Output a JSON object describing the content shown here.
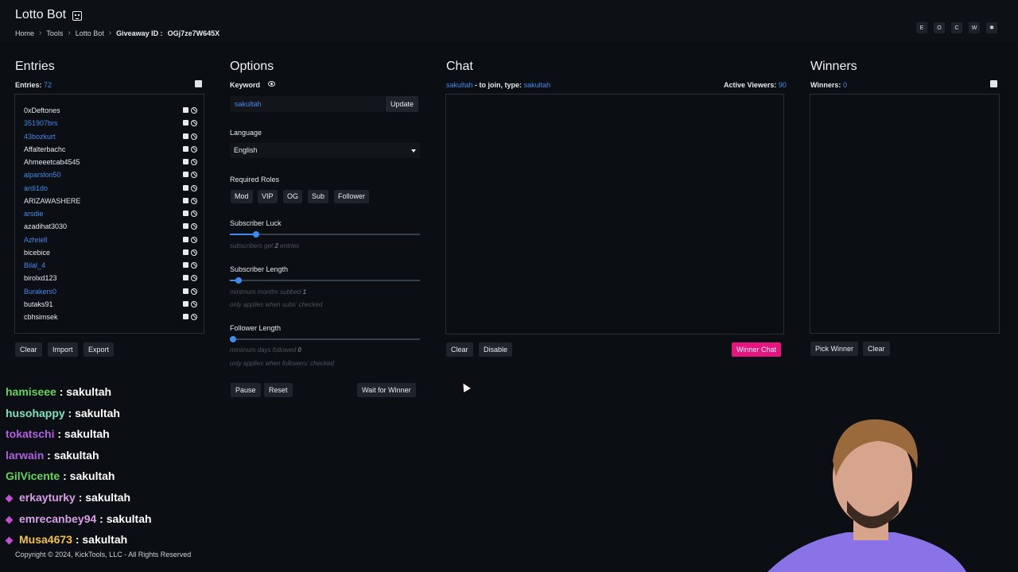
{
  "app": {
    "title": "Lotto Bot"
  },
  "breadcrumb": {
    "home": "Home",
    "tools": "Tools",
    "current": "Lotto Bot",
    "giveaway_label": "Giveaway ID :",
    "giveaway_id": "OGj7ze7W645X"
  },
  "top_buttons": [
    "E",
    "O",
    "C",
    "W",
    "✱"
  ],
  "entries": {
    "title": "Entries",
    "count_label": "Entries:",
    "count": "72",
    "items": [
      {
        "name": "0xDeftones",
        "sub": false
      },
      {
        "name": "351907brs",
        "sub": true
      },
      {
        "name": "43bozkurt",
        "sub": true
      },
      {
        "name": "Affalterbachc",
        "sub": false
      },
      {
        "name": "Ahmeeetcab4545",
        "sub": false
      },
      {
        "name": "alparslon50",
        "sub": true
      },
      {
        "name": "ardi1do",
        "sub": true
      },
      {
        "name": "ARIZAWASHERE",
        "sub": false
      },
      {
        "name": "arsdie",
        "sub": true
      },
      {
        "name": "azadihat3030",
        "sub": false
      },
      {
        "name": "Azhriell",
        "sub": true
      },
      {
        "name": "bicebice",
        "sub": false
      },
      {
        "name": "Bilal_4",
        "sub": true
      },
      {
        "name": "birolxd123",
        "sub": false
      },
      {
        "name": "Burakers0",
        "sub": true
      },
      {
        "name": "butaks91",
        "sub": false
      },
      {
        "name": "cbhsimsek",
        "sub": false
      }
    ],
    "buttons": {
      "clear": "Clear",
      "import": "Import",
      "export": "Export"
    }
  },
  "options": {
    "title": "Options",
    "keyword_label": "Keyword",
    "keyword_value": "sakultah",
    "update_label": "Update",
    "language_label": "Language",
    "language_value": "English",
    "roles_label": "Required Roles",
    "roles": [
      "Mod",
      "VIP",
      "OG",
      "Sub",
      "Follower"
    ],
    "sub_luck_label": "Subscriber Luck",
    "sub_luck_hint_pre": "subscribers get",
    "sub_luck_value": "2",
    "sub_luck_hint_post": "entries",
    "sub_length_label": "Subscriber Length",
    "sub_length_hint_pre": "minimum months subbed",
    "sub_length_value": "1",
    "sub_length_hint2": "only applies when subs' checked",
    "follower_length_label": "Follower Length",
    "follower_length_hint_pre": "minimum days followed",
    "follower_length_value": "0",
    "follower_length_hint2": "only applies when followers' checked",
    "buttons": {
      "pause": "Pause",
      "reset": "Reset",
      "wait": "Wait for Winner"
    }
  },
  "chat": {
    "title": "Chat",
    "join_user": "sakultah",
    "join_text": "- to join, type:",
    "join_keyword": "sakultah",
    "viewers_label": "Active Viewers:",
    "viewers": "90",
    "buttons": {
      "clear": "Clear",
      "disable": "Disable",
      "winner_chat": "Winner Chat"
    }
  },
  "winners": {
    "title": "Winners",
    "count_label": "Winners:",
    "count": "0",
    "buttons": {
      "pick": "Pick Winner",
      "clear": "Clear"
    }
  },
  "overlay_chat": [
    {
      "user": "hamiseee",
      "msg": " : sakultah",
      "color": "#63d35a",
      "badge": false
    },
    {
      "user": "husohappy",
      "msg": " : sakultah",
      "color": "#7fe0bf",
      "badge": false
    },
    {
      "user": "tokatschi",
      "msg": " : sakultah",
      "color": "#b35de0",
      "badge": false
    },
    {
      "user": "larwain",
      "msg": " : sakultah",
      "color": "#b35de0",
      "badge": false
    },
    {
      "user": "GilVicente",
      "msg": " : sakultah",
      "color": "#63d35a",
      "badge": false
    },
    {
      "user": "erkayturky",
      "msg": " : sakultah",
      "color": "#d99ee8",
      "badge": true
    },
    {
      "user": "emrecanbey94",
      "msg": " : sakultah",
      "color": "#d99ee8",
      "badge": true
    },
    {
      "user": "Musa4673",
      "msg": " : sakultah",
      "color": "#f1c24a",
      "badge": true
    }
  ],
  "footer": {
    "copyright": "Copyright © 2024, KickTools, LLC - All Rights Reserved"
  },
  "colors": {
    "accent": "#3d8bef",
    "pink": "#e6147f",
    "bg": "#0b0e12"
  },
  "slider_levels": {
    "sub_luck": 0.12,
    "sub_length": 0.03,
    "follower_length": 0.0
  }
}
